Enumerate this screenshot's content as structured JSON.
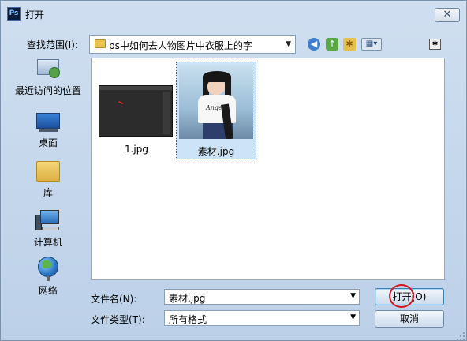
{
  "window": {
    "title": "打开",
    "app_icon_text": "Ps",
    "close_glyph": "✕"
  },
  "lookin": {
    "label": "查找范围(I):",
    "value": "ps中如何去人物图片中衣服上的字"
  },
  "toolbar": {
    "back_glyph": "◀",
    "up_glyph": "↑",
    "newfolder_glyph": "✱",
    "view_glyph": "▦▾",
    "extra_glyph": "✱"
  },
  "places": [
    {
      "label": "最近访问的位置",
      "icon": "recent-places-icon"
    },
    {
      "label": "桌面",
      "icon": "desktop-icon"
    },
    {
      "label": "库",
      "icon": "libraries-icon"
    },
    {
      "label": "计算机",
      "icon": "computer-icon"
    },
    {
      "label": "网络",
      "icon": "network-icon"
    }
  ],
  "files": [
    {
      "name": "1.jpg",
      "selected": false
    },
    {
      "name": "素材.jpg",
      "selected": true,
      "thumb_text": "Angel"
    }
  ],
  "form": {
    "filename_label": "文件名(N):",
    "filename_value": "素材.jpg",
    "filetype_label": "文件类型(T):",
    "filetype_value": "所有格式"
  },
  "buttons": {
    "open": "打开(O)",
    "cancel": "取消"
  },
  "colors": {
    "dialog_bg": "#c9daec",
    "selection_bg": "#cde3f7",
    "annotation_circle": "#d8141b"
  }
}
